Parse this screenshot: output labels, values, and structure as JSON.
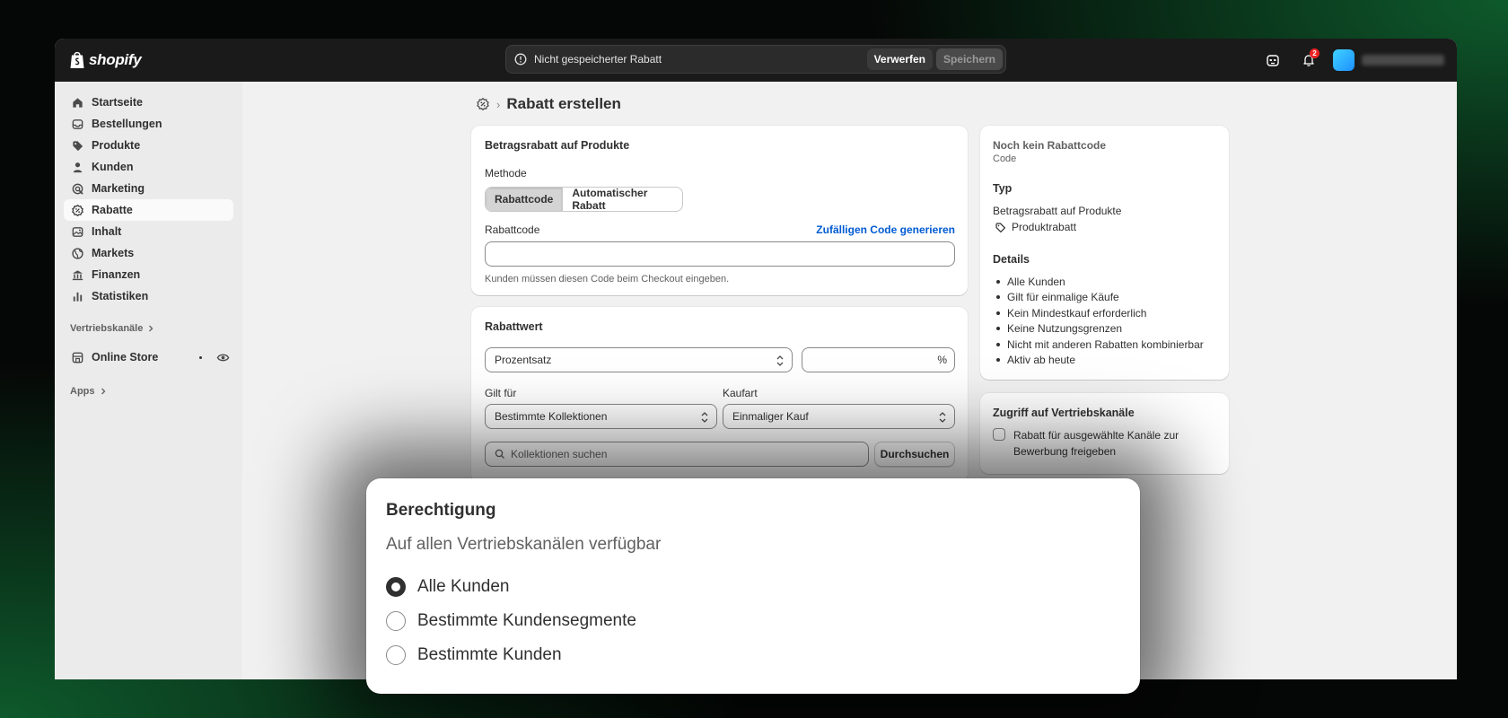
{
  "brand": {
    "name": "shopify"
  },
  "topbar": {
    "unsaved_message": "Nicht gespeicherter Rabatt",
    "discard_label": "Verwerfen",
    "save_label": "Speichern",
    "notification_count": "2"
  },
  "sidebar": {
    "items": [
      {
        "label": "Startseite",
        "icon": "home-icon"
      },
      {
        "label": "Bestellungen",
        "icon": "inbox-icon"
      },
      {
        "label": "Produkte",
        "icon": "tag-icon"
      },
      {
        "label": "Kunden",
        "icon": "person-icon"
      },
      {
        "label": "Marketing",
        "icon": "target-icon"
      },
      {
        "label": "Rabatte",
        "icon": "discount-icon"
      },
      {
        "label": "Inhalt",
        "icon": "content-icon"
      },
      {
        "label": "Markets",
        "icon": "globe-icon"
      },
      {
        "label": "Finanzen",
        "icon": "bank-icon"
      },
      {
        "label": "Statistiken",
        "icon": "chart-bar-icon"
      }
    ],
    "sales_channels_label": "Vertriebskanäle",
    "online_store_label": "Online Store",
    "apps_label": "Apps"
  },
  "page": {
    "title": "Rabatt erstellen"
  },
  "method_card": {
    "title": "Betragsrabatt auf Produkte",
    "method_label": "Methode",
    "method_options": [
      "Rabattcode",
      "Automatischer Rabatt"
    ],
    "code_label": "Rabattcode",
    "generate_link": "Zufälligen Code generieren",
    "code_value": "",
    "helper": "Kunden müssen diesen Code beim Checkout eingeben."
  },
  "value_card": {
    "title": "Rabattwert",
    "type_value": "Prozentsatz",
    "percent_suffix": "%",
    "applies_label": "Gilt für",
    "applies_value": "Bestimmte Kollektionen",
    "purchase_label": "Kaufart",
    "purchase_value": "Einmaliger Kauf",
    "search_placeholder": "Kollektionen suchen",
    "browse_label": "Durchsuchen"
  },
  "summary_card": {
    "code_title": "Noch kein Rabattcode",
    "code_sub": "Code",
    "type_heading": "Typ",
    "type_value": "Betragsrabatt auf Produkte",
    "type_tag": "Produktrabatt",
    "details_heading": "Details",
    "details": [
      "Alle Kunden",
      "Gilt für einmalige Käufe",
      "Kein Mindestkauf erforderlich",
      "Keine Nutzungsgrenzen",
      "Nicht mit anderen Rabatten kombinierbar",
      "Aktiv ab heute"
    ]
  },
  "channels_card": {
    "title": "Zugriff auf Vertriebskanäle",
    "checkbox_label_1": "Rabatt für ausgewählte Kanäle zur",
    "checkbox_label_2": "Bewerbung freigeben"
  },
  "eligibility": {
    "title": "Berechtigung",
    "subtitle": "Auf allen Vertriebskanälen verfügbar",
    "options": [
      "Alle Kunden",
      "Bestimmte Kundensegmente",
      "Bestimmte Kunden"
    ],
    "selected_index": 0
  }
}
